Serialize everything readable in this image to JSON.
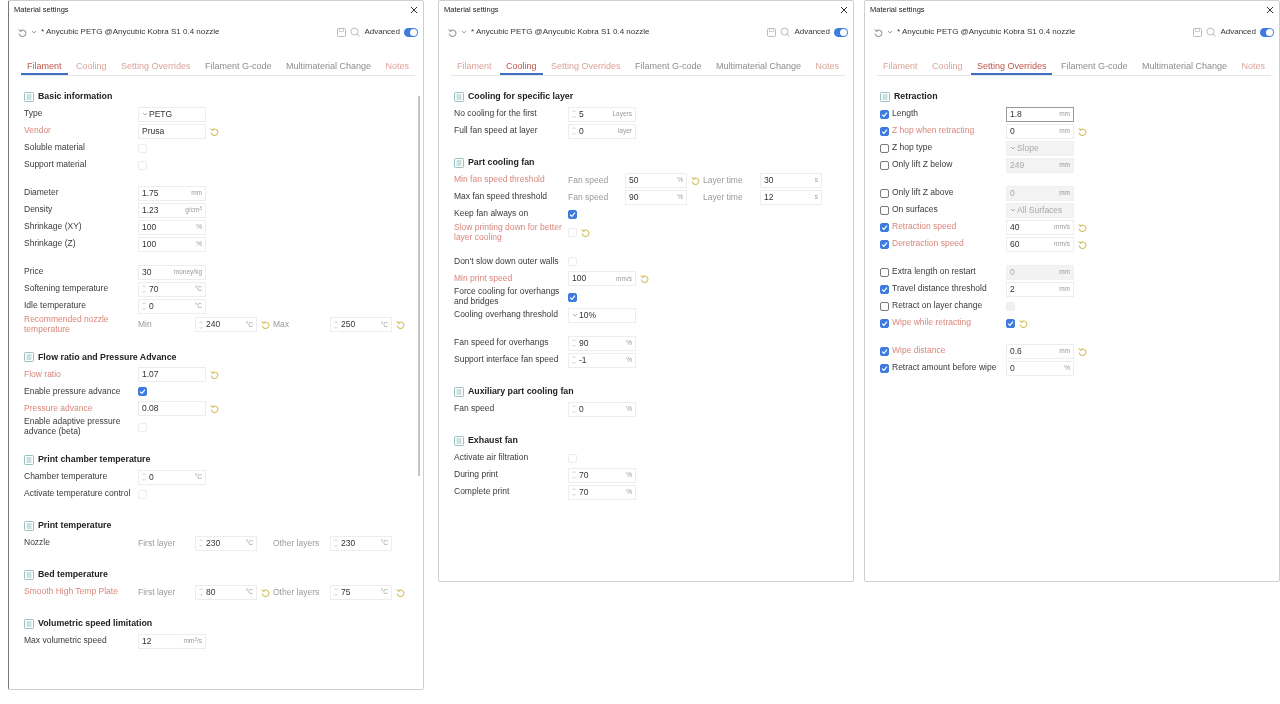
{
  "windows": [
    {
      "title": "Material settings",
      "preset": "* Anycubic PETG @Anycubic Kobra S1 0.4 nozzle",
      "advanced_label": "Advanced",
      "advanced_on": true,
      "tabs": [
        {
          "label": "Filament",
          "selected": true,
          "modified": true
        },
        {
          "label": "Cooling",
          "selected": false,
          "modified": true
        },
        {
          "label": "Setting Overrides",
          "selected": false,
          "modified": true
        },
        {
          "label": "Filament G-code",
          "selected": false,
          "modified": false
        },
        {
          "label": "Multimaterial Change",
          "selected": false,
          "modified": false
        },
        {
          "label": "Notes",
          "selected": false,
          "modified": true
        }
      ],
      "sections": [
        {
          "title": "Basic information",
          "groups": [
            [
              {
                "kind": "combo",
                "label": "Type",
                "value": "PETG",
                "modified": false
              },
              {
                "kind": "field",
                "label": "Vendor",
                "value": "Prusa",
                "modified": true,
                "reset": true
              },
              {
                "kind": "check",
                "label": "Soluble material",
                "checked": false,
                "modified": false
              },
              {
                "kind": "check",
                "label": "Support material",
                "checked": false,
                "modified": false
              }
            ],
            [
              {
                "kind": "field",
                "label": "Diameter",
                "value": "1.75",
                "unit": "mm",
                "modified": false
              },
              {
                "kind": "field",
                "label": "Density",
                "value": "1.23",
                "unit": "g/cm$^{3}$",
                "modified": false
              },
              {
                "kind": "field",
                "label": "Shrinkage (XY)",
                "value": "100",
                "unit": "%",
                "modified": false
              },
              {
                "kind": "field",
                "label": "Shrinkage (Z)",
                "value": "100",
                "unit": "%",
                "modified": false
              }
            ],
            [
              {
                "kind": "field",
                "label": "Price",
                "value": "30",
                "unit": "money/kg",
                "modified": false
              },
              {
                "kind": "field",
                "label": "Softening temperature",
                "value": "70",
                "unit": "°C",
                "spin": true,
                "modified": false
              },
              {
                "kind": "field",
                "label": "Idle temperature",
                "value": "0",
                "unit": "°C",
                "spin": true,
                "modified": false
              },
              {
                "kind": "pair",
                "label": "Recommended nozzle temperature",
                "modified": true,
                "fields": [
                  {
                    "caption": "Min",
                    "value": "240",
                    "unit": "°C",
                    "spin": true,
                    "reset": true
                  },
                  {
                    "caption": "Max",
                    "value": "250",
                    "unit": "°C",
                    "spin": true,
                    "reset": true
                  }
                ]
              }
            ]
          ]
        },
        {
          "title": "Flow ratio and Pressure Advance",
          "groups": [
            [
              {
                "kind": "field",
                "label": "Flow ratio",
                "value": "1.07",
                "modified": true,
                "reset": true
              },
              {
                "kind": "check",
                "label": "Enable pressure advance",
                "checked": true,
                "modified": false
              },
              {
                "kind": "field",
                "label": "Pressure advance",
                "value": "0.08",
                "modified": true,
                "reset": true
              },
              {
                "kind": "check",
                "label": "Enable adaptive pressure advance (beta)",
                "checked": false,
                "modified": false
              }
            ]
          ]
        },
        {
          "title": "Print chamber temperature",
          "groups": [
            [
              {
                "kind": "field",
                "label": "Chamber temperature",
                "value": "0",
                "unit": "°C",
                "spin": true,
                "modified": false
              },
              {
                "kind": "check",
                "label": "Activate temperature control",
                "checked": false,
                "modified": false
              }
            ]
          ]
        },
        {
          "title": "Print temperature",
          "groups": [
            [
              {
                "kind": "pair",
                "label": "Nozzle",
                "modified": false,
                "fields": [
                  {
                    "caption": "First layer",
                    "value": "230",
                    "unit": "°C",
                    "spin": true
                  },
                  {
                    "caption": "Other layers",
                    "value": "230",
                    "unit": "°C",
                    "spin": true
                  }
                ]
              }
            ]
          ]
        },
        {
          "title": "Bed temperature",
          "groups": [
            [
              {
                "kind": "pair",
                "label": "Smooth High Temp Plate",
                "modified": true,
                "fields": [
                  {
                    "caption": "First layer",
                    "value": "80",
                    "unit": "°C",
                    "spin": true,
                    "reset": true
                  },
                  {
                    "caption": "Other layers",
                    "value": "75",
                    "unit": "°C",
                    "spin": true,
                    "reset": true
                  }
                ]
              }
            ]
          ]
        },
        {
          "title": "Volumetric speed limitation",
          "groups": [
            [
              {
                "kind": "field",
                "label": "Max volumetric speed",
                "value": "12",
                "unit": "mm$^{3}$/s",
                "modified": false
              }
            ]
          ]
        }
      ]
    },
    {
      "title": "Material settings",
      "preset": "* Anycubic PETG @Anycubic Kobra S1 0.4 nozzle",
      "advanced_label": "Advanced",
      "advanced_on": true,
      "tabs": [
        {
          "label": "Filament",
          "selected": false,
          "modified": true
        },
        {
          "label": "Cooling",
          "selected": true,
          "modified": true
        },
        {
          "label": "Setting Overrides",
          "selected": false,
          "modified": true
        },
        {
          "label": "Filament G-code",
          "selected": false,
          "modified": false
        },
        {
          "label": "Multimaterial Change",
          "selected": false,
          "modified": false
        },
        {
          "label": "Notes",
          "selected": false,
          "modified": true
        }
      ],
      "sections": [
        {
          "title": "Cooling for specific layer",
          "groups": [
            [
              {
                "kind": "field",
                "label": "No cooling for the first",
                "value": "5",
                "unit": "Layers",
                "spin": true,
                "modified": false
              },
              {
                "kind": "field",
                "label": "Full fan speed at layer",
                "value": "0",
                "unit": "layer",
                "spin": true,
                "modified": false
              }
            ]
          ]
        },
        {
          "title": "Part cooling fan",
          "groups": [
            [
              {
                "kind": "pair",
                "label": "Min fan speed threshold",
                "modified": true,
                "fields": [
                  {
                    "caption": "Fan speed",
                    "value": "50",
                    "unit": "%",
                    "reset": true
                  },
                  {
                    "caption": "Layer time",
                    "value": "30",
                    "unit": "s"
                  }
                ]
              },
              {
                "kind": "pair",
                "label": "Max fan speed threshold",
                "modified": false,
                "fields": [
                  {
                    "caption": "Fan speed",
                    "value": "90",
                    "unit": "%"
                  },
                  {
                    "caption": "Layer time",
                    "value": "12",
                    "unit": "s"
                  }
                ]
              },
              {
                "kind": "check",
                "label": "Keep fan always on",
                "checked": true,
                "modified": false
              },
              {
                "kind": "check",
                "label": "Slow printing down for better layer cooling",
                "checked": false,
                "modified": true,
                "reset": true
              }
            ],
            [
              {
                "kind": "check",
                "label": "Don't slow down outer walls",
                "checked": false,
                "modified": false
              },
              {
                "kind": "field",
                "label": "Min print speed",
                "value": "100",
                "unit": "mm/s",
                "modified": true,
                "reset": true
              },
              {
                "kind": "check",
                "label": "Force cooling for overhangs and bridges",
                "checked": true,
                "modified": false
              },
              {
                "kind": "combo",
                "label": "Cooling overhang threshold",
                "value": "10%",
                "modified": false
              }
            ],
            [
              {
                "kind": "field",
                "label": "Fan speed for overhangs",
                "value": "90",
                "unit": "%",
                "spin": true,
                "modified": false
              },
              {
                "kind": "field",
                "label": "Support interface fan speed",
                "value": "-1",
                "unit": "%",
                "spin": true,
                "modified": false
              }
            ]
          ]
        },
        {
          "title": "Auxiliary part cooling fan",
          "groups": [
            [
              {
                "kind": "field",
                "label": "Fan speed",
                "value": "0",
                "unit": "%",
                "spin": true,
                "modified": false
              }
            ]
          ]
        },
        {
          "title": "Exhaust fan",
          "groups": [
            [
              {
                "kind": "check",
                "label": "Activate air filtration",
                "checked": false,
                "modified": false
              },
              {
                "kind": "field",
                "label": "During print",
                "value": "70",
                "unit": "%",
                "spin": true,
                "modified": false
              },
              {
                "kind": "field",
                "label": "Complete print",
                "value": "70",
                "unit": "%",
                "spin": true,
                "modified": false
              }
            ]
          ]
        }
      ]
    },
    {
      "title": "Material settings",
      "preset": "* Anycubic PETG @Anycubic Kobra S1 0.4 nozzle",
      "advanced_label": "Advanced",
      "advanced_on": true,
      "tabs": [
        {
          "label": "Filament",
          "selected": false,
          "modified": true
        },
        {
          "label": "Cooling",
          "selected": false,
          "modified": true
        },
        {
          "label": "Setting Overrides",
          "selected": true,
          "modified": true
        },
        {
          "label": "Filament G-code",
          "selected": false,
          "modified": false
        },
        {
          "label": "Multimaterial Change",
          "selected": false,
          "modified": false
        },
        {
          "label": "Notes",
          "selected": false,
          "modified": true
        }
      ],
      "sections": [
        {
          "title": "Retraction",
          "groups": [
            [
              {
                "kind": "field",
                "label": "Length",
                "value": "1.8",
                "unit": "mm",
                "override": true,
                "disabled": false,
                "focused": true,
                "modified": false
              },
              {
                "kind": "field",
                "label": "Z hop when retracting",
                "value": "0",
                "unit": "mm",
                "override": true,
                "disabled": false,
                "modified": true,
                "reset": true
              },
              {
                "kind": "combo",
                "label": "Z hop type",
                "value": "Slope",
                "override": false,
                "disabled": true,
                "modified": false
              },
              {
                "kind": "field",
                "label": "Only lift Z below",
                "value": "249",
                "unit": "mm",
                "override": false,
                "disabled": true,
                "modified": false
              }
            ],
            [
              {
                "kind": "field",
                "label": "Only lift Z above",
                "value": "0",
                "unit": "mm",
                "override": false,
                "disabled": true,
                "modified": false
              },
              {
                "kind": "combo",
                "label": "On surfaces",
                "value": "All Surfaces",
                "override": false,
                "disabled": true,
                "modified": false
              },
              {
                "kind": "field",
                "label": "Retraction speed",
                "value": "40",
                "unit": "mm/s",
                "override": true,
                "disabled": false,
                "modified": true,
                "reset": true
              },
              {
                "kind": "field",
                "label": "Deretraction speed",
                "value": "60",
                "unit": "mm/s",
                "override": true,
                "disabled": false,
                "modified": true,
                "reset": true
              }
            ],
            [
              {
                "kind": "field",
                "label": "Extra length on restart",
                "value": "0",
                "unit": "mm",
                "override": false,
                "disabled": true,
                "modified": false
              },
              {
                "kind": "field",
                "label": "Travel distance threshold",
                "value": "2",
                "unit": "mm",
                "override": true,
                "disabled": false,
                "modified": false
              },
              {
                "kind": "check",
                "label": "Retract on layer change",
                "checked": false,
                "override": false,
                "disabled": true,
                "modified": false
              },
              {
                "kind": "check",
                "label": "Wipe while retracting",
                "checked": true,
                "override": true,
                "disabled": false,
                "modified": true,
                "reset": true
              }
            ],
            [
              {
                "kind": "field",
                "label": "Wipe distance",
                "value": "0.6",
                "unit": "mm",
                "override": true,
                "disabled": false,
                "modified": true,
                "reset": true
              },
              {
                "kind": "field",
                "label": "Retract amount before wipe",
                "value": "0",
                "unit": "%",
                "override": true,
                "disabled": false,
                "modified": false
              }
            ]
          ]
        }
      ]
    }
  ]
}
